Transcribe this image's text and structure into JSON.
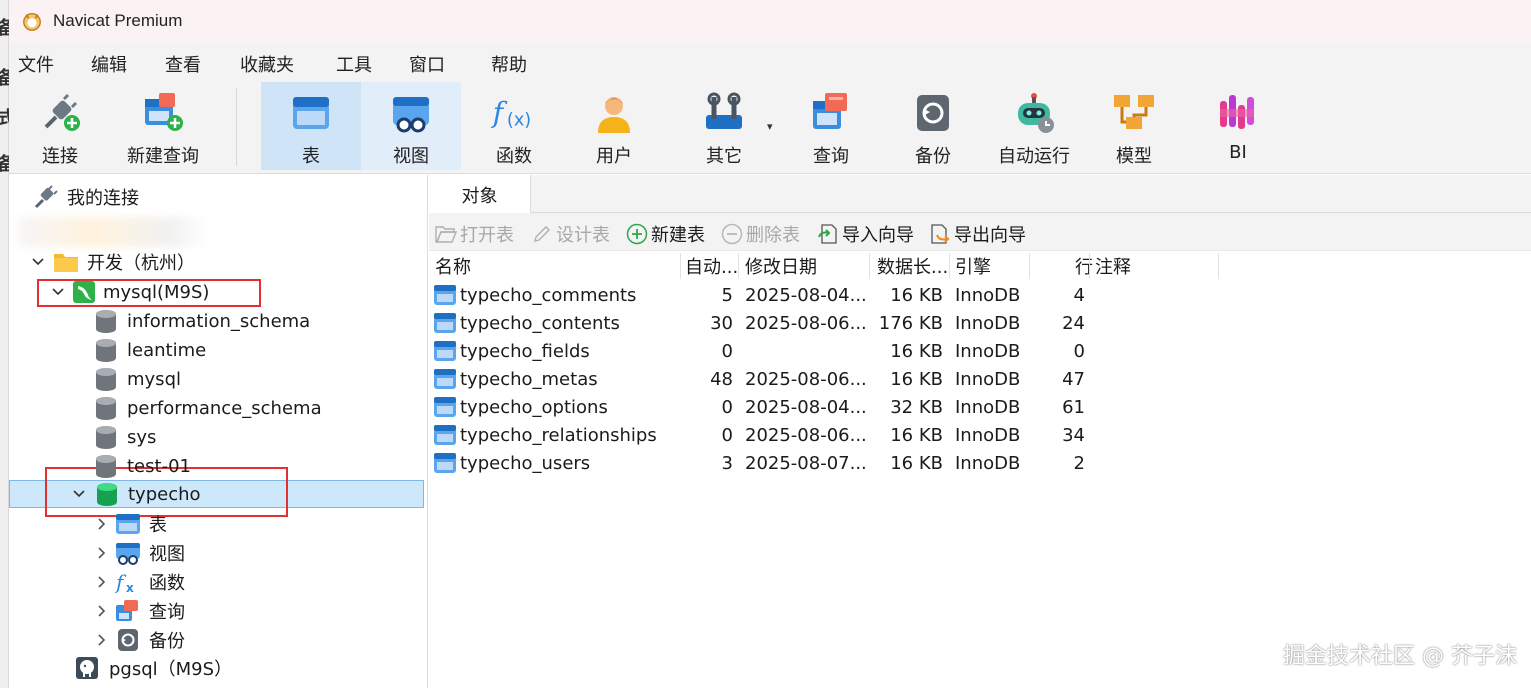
{
  "window": {
    "title": "Navicat Premium"
  },
  "menu": [
    "文件",
    "编辑",
    "查看",
    "收藏夹",
    "工具",
    "窗口",
    "帮助"
  ],
  "toolbar": {
    "buttons": [
      {
        "label": "连接",
        "icon": "plug-icon"
      },
      {
        "label": "新建查询",
        "icon": "new-query-icon"
      },
      {
        "label": "表",
        "icon": "table-icon",
        "active": true
      },
      {
        "label": "视图",
        "icon": "view-icon"
      },
      {
        "label": "函数",
        "icon": "function-icon"
      },
      {
        "label": "用户",
        "icon": "user-icon"
      },
      {
        "label": "其它",
        "icon": "tools-icon"
      },
      {
        "label": "查询",
        "icon": "query-icon"
      },
      {
        "label": "备份",
        "icon": "backup-icon"
      },
      {
        "label": "自动运行",
        "icon": "robot-icon"
      },
      {
        "label": "模型",
        "icon": "model-icon"
      },
      {
        "label": "BI",
        "icon": "bi-icon"
      }
    ]
  },
  "nav": {
    "root": "我的连接",
    "group": "开发（杭州）",
    "connection": "mysql(M9S)",
    "databases": [
      "information_schema",
      "leantime",
      "mysql",
      "performance_schema",
      "sys",
      "test-01",
      "typecho"
    ],
    "selected_db": "typecho",
    "children": [
      "表",
      "视图",
      "函数",
      "查询",
      "备份"
    ],
    "pg_connection": "pgsql（M9S）"
  },
  "content": {
    "tab": "对象",
    "actions": {
      "open": "打开表",
      "design": "设计表",
      "new": "新建表",
      "delete": "删除表",
      "import": "导入向导",
      "export": "导出向导"
    },
    "columns": [
      "名称",
      "自动...",
      "修改日期",
      "数据长...",
      "引擎",
      "行",
      "注释"
    ],
    "rows": [
      {
        "name": "typecho_comments",
        "auto": "5",
        "modified": "2025-08-04...",
        "size": "16 KB",
        "engine": "InnoDB",
        "rows": "4"
      },
      {
        "name": "typecho_contents",
        "auto": "30",
        "modified": "2025-08-06...",
        "size": "176 KB",
        "engine": "InnoDB",
        "rows": "24"
      },
      {
        "name": "typecho_fields",
        "auto": "0",
        "modified": "",
        "size": "16 KB",
        "engine": "InnoDB",
        "rows": "0"
      },
      {
        "name": "typecho_metas",
        "auto": "48",
        "modified": "2025-08-06...",
        "size": "16 KB",
        "engine": "InnoDB",
        "rows": "47"
      },
      {
        "name": "typecho_options",
        "auto": "0",
        "modified": "2025-08-04...",
        "size": "32 KB",
        "engine": "InnoDB",
        "rows": "61"
      },
      {
        "name": "typecho_relationships",
        "auto": "0",
        "modified": "2025-08-06...",
        "size": "16 KB",
        "engine": "InnoDB",
        "rows": "34"
      },
      {
        "name": "typecho_users",
        "auto": "3",
        "modified": "2025-08-07...",
        "size": "16 KB",
        "engine": "InnoDB",
        "rows": "2"
      }
    ]
  },
  "watermark": "掘金技术社区 @ 芥子沫"
}
